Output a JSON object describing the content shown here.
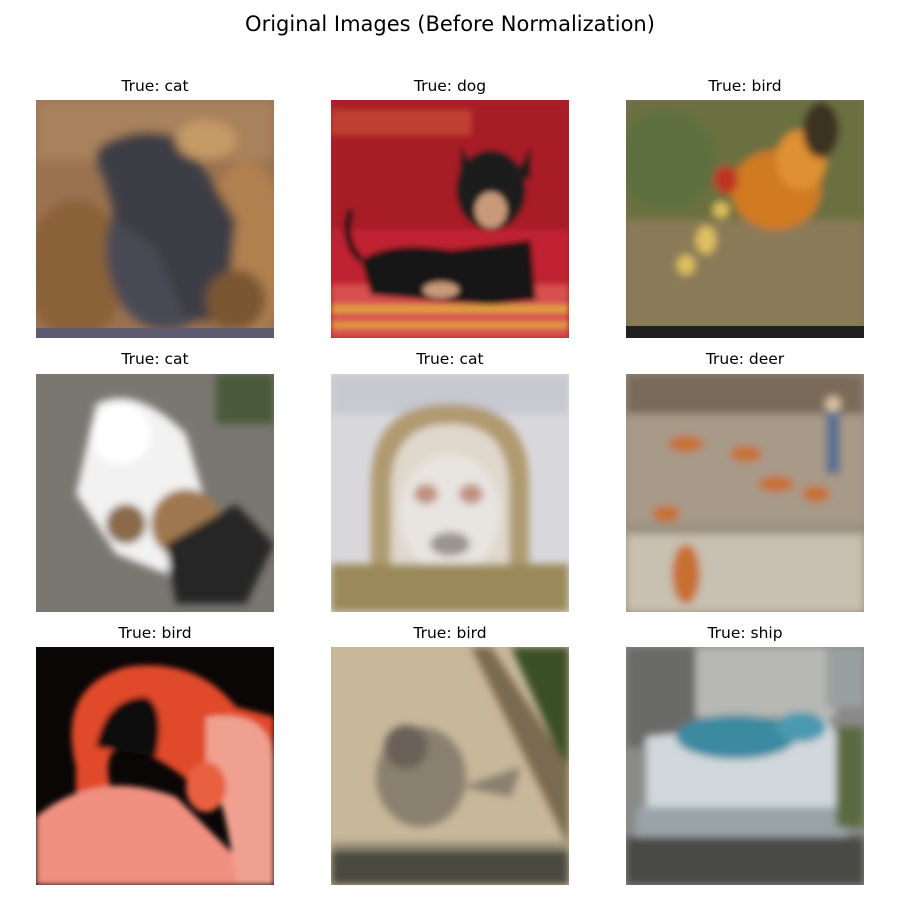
{
  "figure": {
    "title": "Original Images (Before Normalization)"
  },
  "panels": [
    {
      "title": "True: cat",
      "subject": "cat"
    },
    {
      "title": "True: dog",
      "subject": "dog"
    },
    {
      "title": "True: bird",
      "subject": "bird-rooster"
    },
    {
      "title": "True: cat",
      "subject": "cat"
    },
    {
      "title": "True: cat",
      "subject": "cat"
    },
    {
      "title": "True: deer",
      "subject": "deer"
    },
    {
      "title": "True: bird",
      "subject": "bird-flamingo"
    },
    {
      "title": "True: bird",
      "subject": "bird"
    },
    {
      "title": "True: ship",
      "subject": "ship"
    }
  ]
}
